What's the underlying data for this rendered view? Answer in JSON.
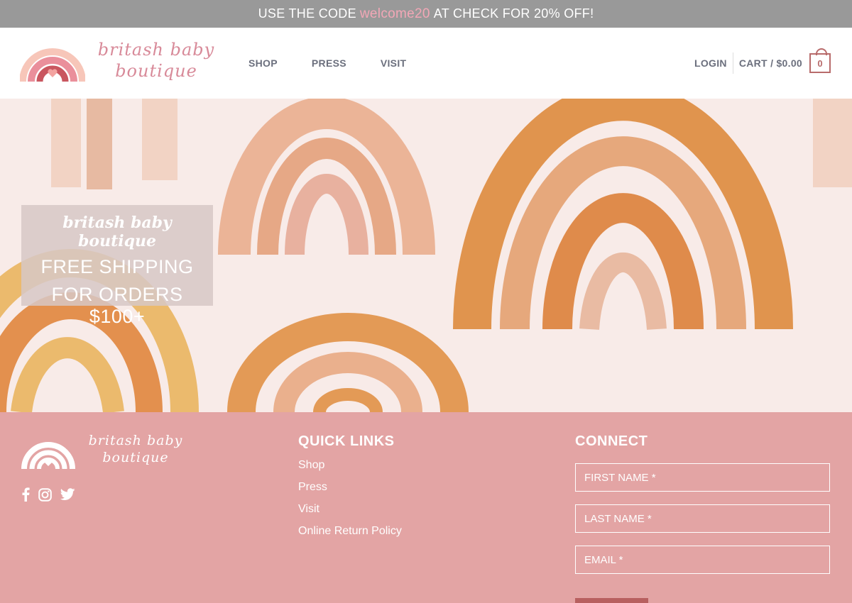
{
  "promo_bar": {
    "prefix": "USE THE CODE",
    "code": "welcome20",
    "suffix": "AT CHECK FOR 20% OFF!"
  },
  "header": {
    "logo_text_line1": "britash baby",
    "logo_text_line2": "boutique",
    "nav": [
      "SHOP",
      "PRESS",
      "VISIT"
    ],
    "login": "LOGIN",
    "cart_label": "CART / $0.00",
    "cart_count": "0"
  },
  "hero": {
    "brand": "britash baby boutique",
    "line1": "FREE SHIPPING",
    "line2": "FOR ORDERS $100+"
  },
  "footer": {
    "logo_text_line1": "britash baby",
    "logo_text_line2": "boutique",
    "social_icons": [
      "facebook-icon",
      "instagram-icon",
      "twitter-icon"
    ],
    "quick_links_title": "QUICK LINKS",
    "quick_links": [
      "Shop",
      "Press",
      "Visit",
      "Online Return Policy"
    ],
    "connect_title": "CONNECT",
    "fields": {
      "first_name": "FIRST NAME *",
      "last_name": "LAST NAME *",
      "email": "EMAIL *"
    }
  },
  "colors": {
    "promo_bg": "#999999",
    "promo_code": "#f2a7b6",
    "footer_bg": "#e3a4a4",
    "hero_bg": "#f8ebe8",
    "accent": "#b86b6b"
  }
}
